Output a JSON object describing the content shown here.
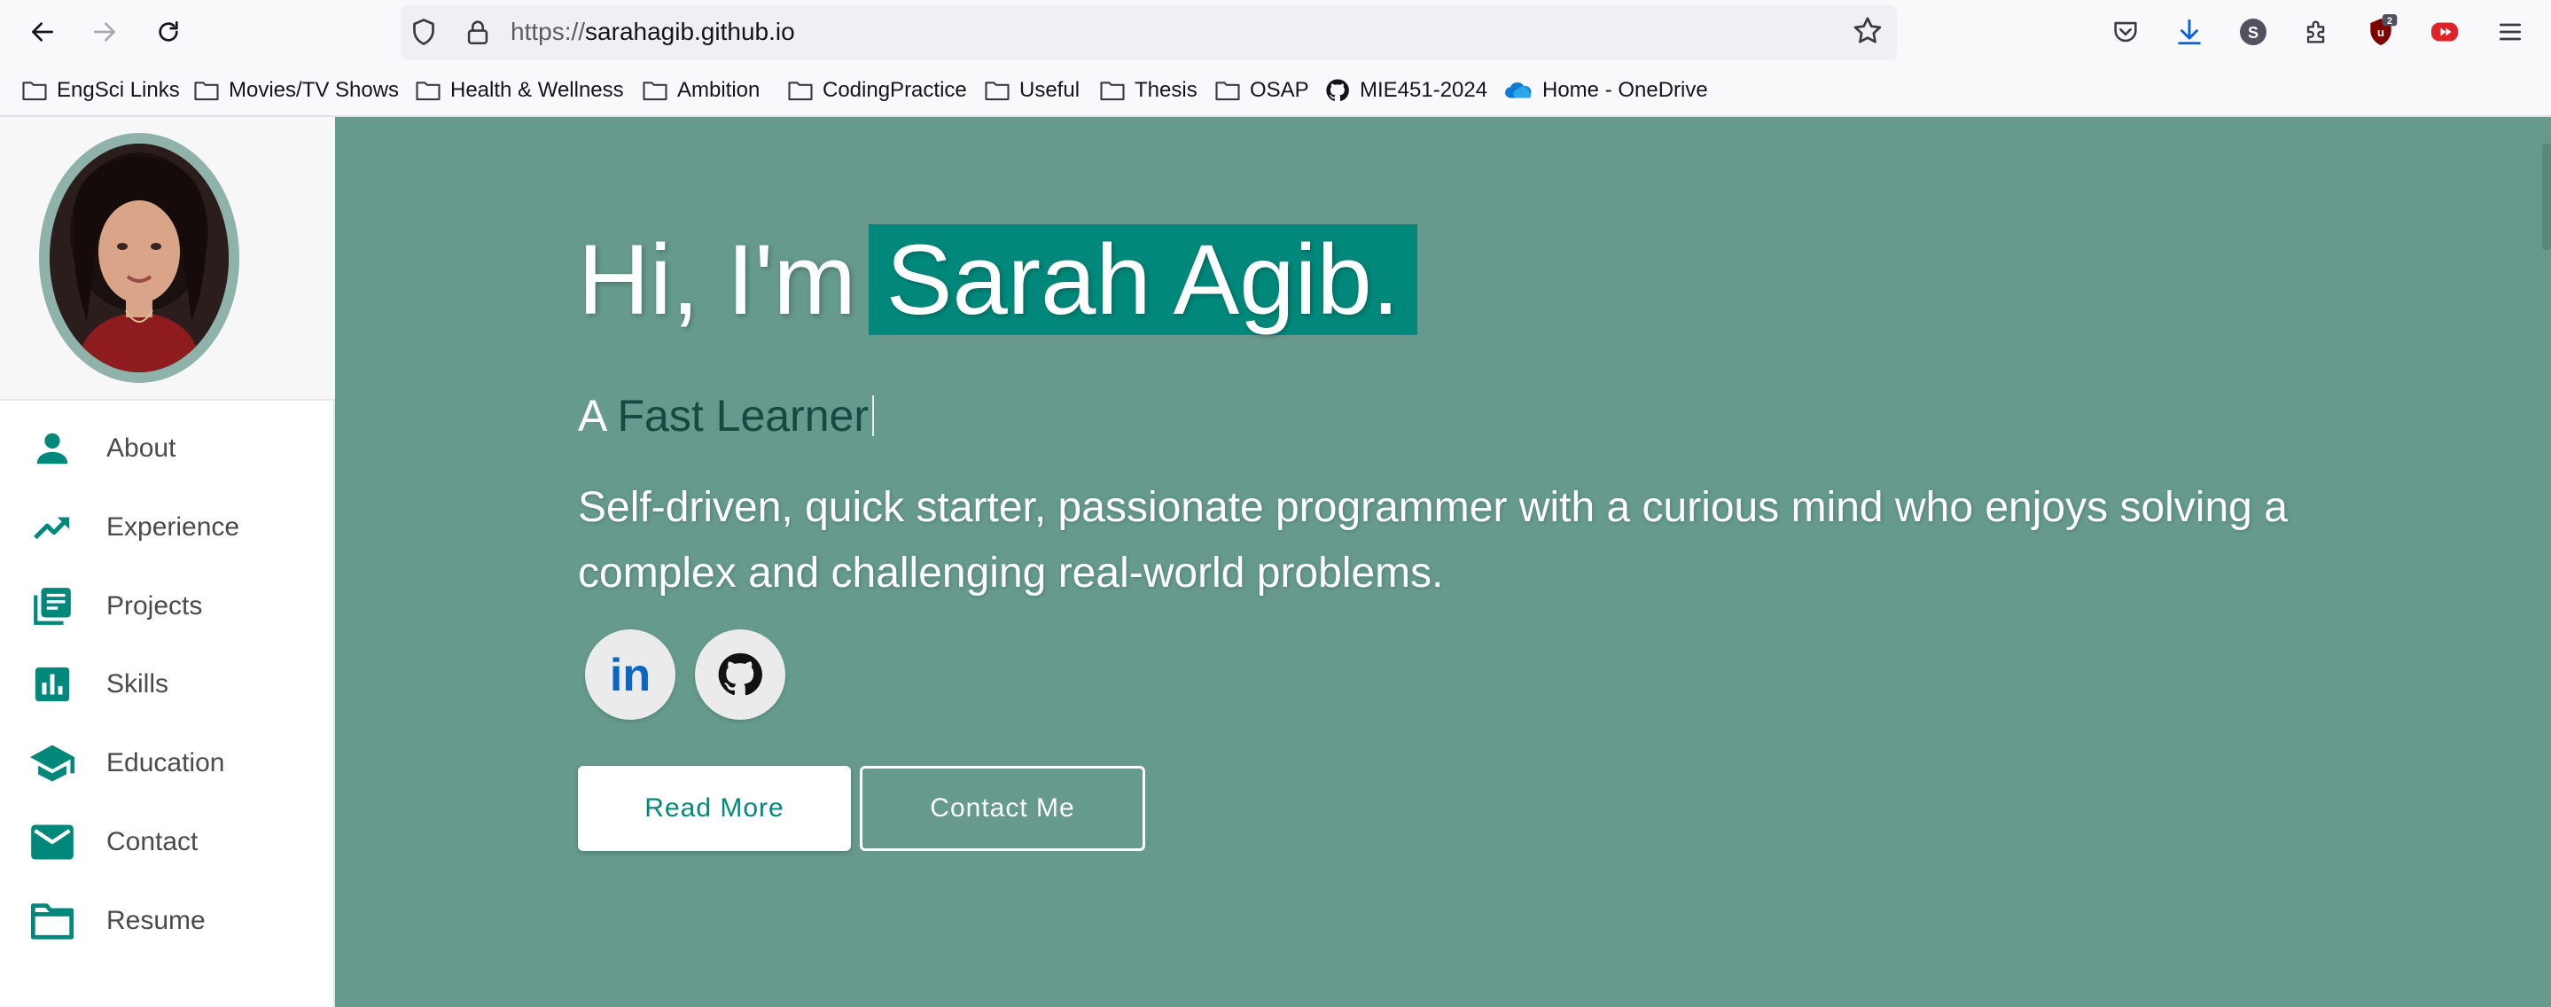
{
  "browser": {
    "url_protocol": "https://",
    "url_domain": "sarahagib.github.io",
    "extension_badge": "2",
    "bookmarks": [
      {
        "label": "EngSci Links",
        "icon": "folder-icon"
      },
      {
        "label": "Movies/TV Shows",
        "icon": "folder-icon"
      },
      {
        "label": "Health & Wellness",
        "icon": "folder-icon"
      },
      {
        "label": "Ambition",
        "icon": "folder-icon"
      },
      {
        "label": "CodingPractice",
        "icon": "folder-icon"
      },
      {
        "label": "Useful",
        "icon": "folder-icon"
      },
      {
        "label": "Thesis",
        "icon": "folder-icon"
      },
      {
        "label": "OSAP",
        "icon": "folder-icon"
      },
      {
        "label": "MIE451-2024",
        "icon": "github-icon"
      },
      {
        "label": "Home - OneDrive",
        "icon": "onedrive-icon"
      }
    ]
  },
  "sidebar": {
    "items": [
      {
        "label": "About",
        "icon": "person-icon"
      },
      {
        "label": "Experience",
        "icon": "trending-up-icon"
      },
      {
        "label": "Projects",
        "icon": "library-books-icon"
      },
      {
        "label": "Skills",
        "icon": "bar-chart-icon"
      },
      {
        "label": "Education",
        "icon": "school-icon"
      },
      {
        "label": "Contact",
        "icon": "mail-icon"
      },
      {
        "label": "Resume",
        "icon": "folder-icon"
      }
    ]
  },
  "hero": {
    "greeting": "Hi, I'm",
    "name": "Sarah Agib.",
    "tagline_prefix": "A",
    "tagline_typed": "Fast Learner",
    "bio": "Self-driven, quick starter, passionate programmer with a curious mind who enjoys solving a complex and challenging real-world problems.",
    "read_more_label": "Read More",
    "contact_label": "Contact Me",
    "social": [
      {
        "label": "in",
        "icon": "linkedin-icon"
      },
      {
        "label": "",
        "icon": "github-icon"
      }
    ]
  },
  "colors": {
    "accent": "#00897b",
    "hero_bg": "#659a8d",
    "typed_text": "#16493f"
  }
}
